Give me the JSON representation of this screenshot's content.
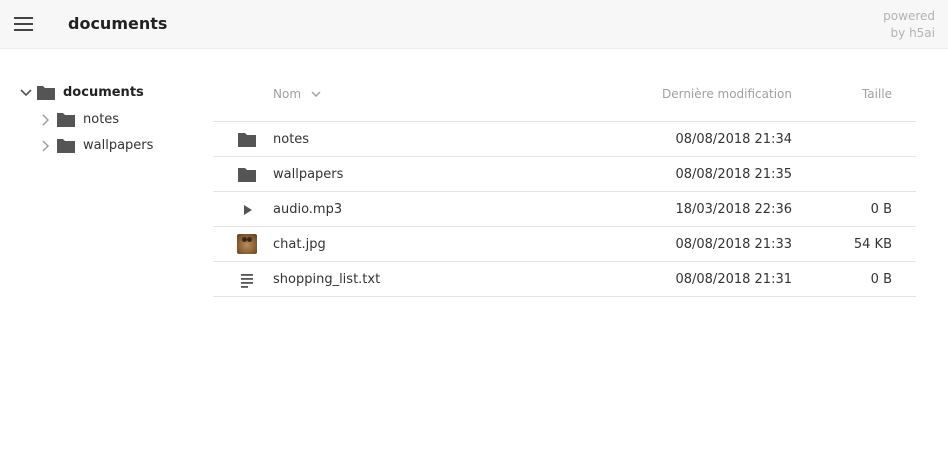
{
  "header": {
    "title": "documents",
    "powered_line1": "powered",
    "powered_line2": "by h5ai",
    "menu_icon": "hamburger-menu-icon"
  },
  "tree": {
    "root": {
      "label": "documents",
      "expanded": true
    },
    "children": [
      {
        "label": "notes",
        "expanded": false
      },
      {
        "label": "wallpapers",
        "expanded": false
      }
    ]
  },
  "list": {
    "columns": {
      "name": "Nom",
      "date": "Dernière modification",
      "size": "Taille"
    },
    "sort": {
      "column": "name",
      "direction": "down"
    },
    "items": [
      {
        "icon": "folder-icon",
        "name": "notes",
        "date": "08/08/2018 21:34",
        "size": ""
      },
      {
        "icon": "folder-icon",
        "name": "wallpapers",
        "date": "08/08/2018 21:35",
        "size": ""
      },
      {
        "icon": "play-icon",
        "name": "audio.mp3",
        "date": "18/03/2018 22:36",
        "size": "0 B"
      },
      {
        "icon": "image-thumbnail-icon",
        "name": "chat.jpg",
        "date": "08/08/2018 21:33",
        "size": "54 KB"
      },
      {
        "icon": "text-file-icon",
        "name": "shopping_list.txt",
        "date": "08/08/2018 21:31",
        "size": "0 B"
      }
    ]
  },
  "colors": {
    "topbar_bg": "#f7f7f7",
    "icon": "#555555",
    "text": "#333333",
    "muted": "#a0a0a0",
    "divider": "#e4e4e4"
  }
}
